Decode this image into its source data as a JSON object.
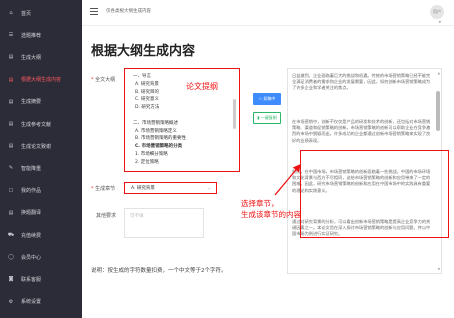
{
  "sidebar": {
    "items": [
      {
        "icon": "home-icon",
        "glyph": "⌂",
        "label": "首页",
        "active": false
      },
      {
        "icon": "list-icon",
        "glyph": "☰",
        "label": "选题推荐",
        "active": false
      },
      {
        "icon": "doc-icon",
        "glyph": "▤",
        "label": "生成大纲",
        "active": false
      },
      {
        "icon": "doc-icon",
        "glyph": "▤",
        "label": "根据大纲生成内容",
        "active": true
      },
      {
        "icon": "doc-icon",
        "glyph": "▤",
        "label": "生成摘要",
        "active": false
      },
      {
        "icon": "doc-icon",
        "glyph": "▤",
        "label": "生成参考文献",
        "active": false
      },
      {
        "icon": "doc-icon",
        "glyph": "▤",
        "label": "生成论文致谢",
        "active": false
      },
      {
        "icon": "edit-icon",
        "glyph": "✎",
        "label": "智能降重",
        "active": false
      },
      {
        "icon": "gift-icon",
        "glyph": "☐",
        "label": "我的作品",
        "active": false
      },
      {
        "icon": "doc-icon",
        "glyph": "▤",
        "label": "换题翻译",
        "active": false
      },
      {
        "icon": "cart-icon",
        "glyph": "⛟",
        "label": "充值续费",
        "active": false
      },
      {
        "icon": "user-icon",
        "glyph": "◯",
        "label": "会员中心",
        "active": false
      },
      {
        "icon": "service-icon",
        "glyph": "◙",
        "label": "联系客服",
        "active": false
      },
      {
        "icon": "gear-icon",
        "glyph": "⚙",
        "label": "系统设置",
        "active": false
      }
    ]
  },
  "topbar": {
    "title": "仅各类根大纲生成内容",
    "avatar_text": "用户"
  },
  "main": {
    "page_title": "根据大纲生成内容",
    "outline_label": "全文大纲",
    "outline_lines": [
      {
        "text": "一、导言",
        "cls": ""
      },
      {
        "text": "A. 研究背景",
        "cls": "sub"
      },
      {
        "text": "B. 研究目的",
        "cls": "sub"
      },
      {
        "text": "C. 研究意义",
        "cls": "sub"
      },
      {
        "text": "D. 研究方法",
        "cls": "sub"
      },
      {
        "text": "",
        "cls": ""
      },
      {
        "text": "二、市场营销策略概述",
        "cls": ""
      },
      {
        "text": "A. 市场营销策略定义",
        "cls": "sub"
      },
      {
        "text": "B. 市场营销策略的重要性",
        "cls": "sub"
      },
      {
        "text": "C. 市场营销策略的分类",
        "cls": "sub bold"
      },
      {
        "text": "1. 市场细分策略",
        "cls": "sub"
      },
      {
        "text": "2. 定位策略",
        "cls": "sub"
      }
    ],
    "outline_annotation": "论文提纲",
    "btn_generate": "☆ 如稿中",
    "btn_copy": "▮ 一键复制",
    "content_paragraphs": [
      "日益激烈，企业面临着巨大的挑战和机遇。传统的市场营销策略已经不能完全满足消费者的需求和企业的发展需要，因此，如何创新市场营销策略成为了许多企业和学者关注的焦点。",
      "在市场营销中，创新不仅仅是产品的研发和技术的创新，还包括对市场营销策略、渠道和促销策略的创新。市场营销策略的创新可以帮助企业在竞争激烈的市场中脱颖而出，许多成功的企业都通过创新市场营销策略来实现了良好的业绩表现。",
      "然而，在中国市场，市场营销策略的创新面临着一些挑战。中国的市场环境和文化背景与西方不尽相同，这给市场营销策略的创新和应用带来了一定的困难。因此，研究市场营销策略的创新和应用在中国市场中的实践具有重要的理论和实践意义。",
      "通过对研究背景的分析，可以看出创新市场营销策略是提高企业竞争力的关键因素之一。本论文旨在深入探讨市场营销策略的创新与应用问题，并以中国市场为例进行实证研究。"
    ],
    "chapter_label": "生成章节",
    "chapter_value": "A. 研究背景",
    "chapter_annotation_line1": "选择章节，",
    "chapter_annotation_line2": "生成该章节的内容",
    "requirement_label": "其他要求",
    "requirement_placeholder": "可不填",
    "note": "说明：按生成的字符数量扣费，一个中文等于2个字符。"
  },
  "colors": {
    "sidebar_bg": "#2c2c38",
    "active": "#ff5a5f",
    "annotation": "#ee1111",
    "primary": "#3d8bfd",
    "success": "#2cb66a"
  }
}
